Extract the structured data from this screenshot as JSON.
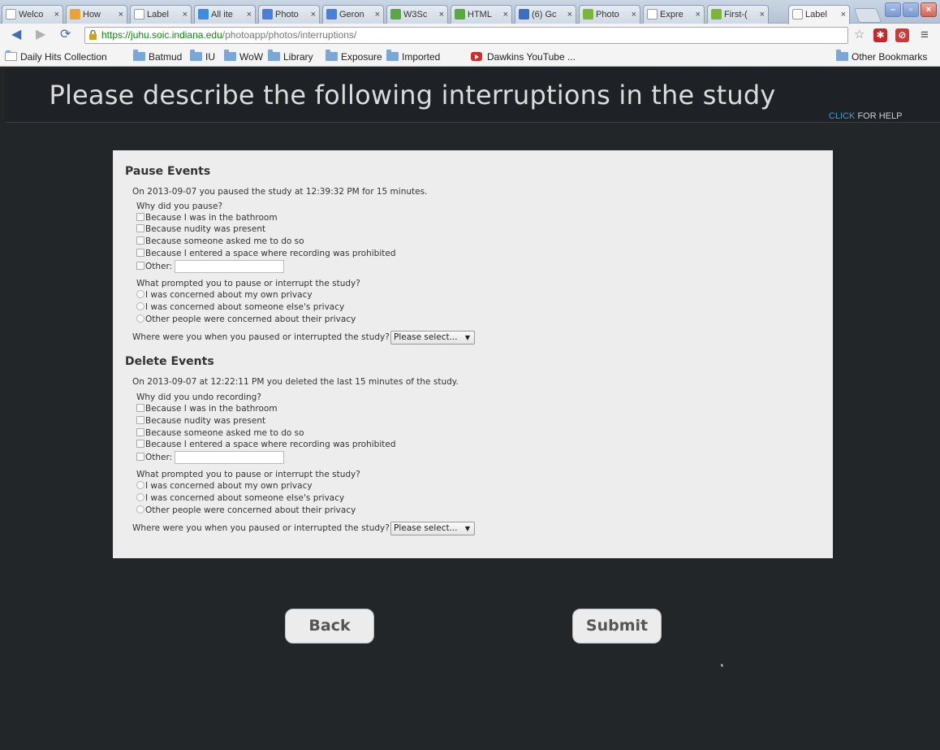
{
  "browser": {
    "tabs": [
      {
        "label": "Welco",
        "color": "#e8e8e8"
      },
      {
        "label": "How",
        "color": "#e8a33a"
      },
      {
        "label": "Label",
        "color": "#e8e8e8"
      },
      {
        "label": "All ite",
        "color": "#3c8de0"
      },
      {
        "label": "Photo",
        "color": "#4a7fd9"
      },
      {
        "label": "Geron",
        "color": "#4a7fd9"
      },
      {
        "label": "W3Sc",
        "color": "#5aa843"
      },
      {
        "label": "HTML",
        "color": "#5aa843"
      },
      {
        "label": "(6) Gc",
        "color": "#3c6fc4"
      },
      {
        "label": "Photo",
        "color": "#7db53a"
      },
      {
        "label": "Expre",
        "color": "#e8e8e8"
      },
      {
        "label": "First-(",
        "color": "#7db53a"
      },
      {
        "label": "Label",
        "color": "#e8e8e8"
      }
    ],
    "url_scheme": "https://",
    "url_host": "juhu.soic.indiana.edu",
    "url_path": "/photoapp/photos/interruptions/",
    "bookmarks": [
      "Daily Hits Collection",
      "Batmud",
      "IU",
      "WoW",
      "Library",
      "Exposure",
      "Imported",
      "Dawkins YouTube ...",
      "Other Bookmarks"
    ]
  },
  "header": {
    "title": "Please describe the following interruptions in the study",
    "help_link": "CLICK",
    "help_text": " FOR HELP"
  },
  "pause": {
    "title": "Pause Events",
    "summary": "On 2013-09-07 you paused the study at 12:39:32 PM for 15 minutes.",
    "why_label": "Why did you pause?",
    "reasons": [
      "Because I was in the bathroom",
      "Because nudity was present",
      "Because someone asked me to do so",
      "Because I entered a space where recording was prohibited"
    ],
    "other_label": "Other:",
    "other_value": "",
    "prompt_label": "What prompted you to pause or interrupt the study?",
    "prompts": [
      "I was concerned about my own privacy",
      "I was concerned about someone else's privacy",
      "Other people were concerned about their privacy"
    ],
    "where_label": "Where were you when you paused or interrupted the study?",
    "where_value": "Please select..."
  },
  "delete": {
    "title": "Delete Events",
    "summary": "On 2013-09-07 at 12:22:11 PM you deleted the last 15 minutes of the study.",
    "why_label": "Why did you undo recording?",
    "reasons": [
      "Because I was in the bathroom",
      "Because nudity was present",
      "Because someone asked me to do so",
      "Because I entered a space where recording was prohibited"
    ],
    "other_label": "Other:",
    "other_value": "",
    "prompt_label": "What prompted you to pause or interrupt the study?",
    "prompts": [
      "I was concerned about my own privacy",
      "I was concerned about someone else's privacy",
      "Other people were concerned about their privacy"
    ],
    "where_label": "Where were you when you paused or interrupted the study?",
    "where_value": "Please select..."
  },
  "actions": {
    "back_label": "Back",
    "submit_label": "Submit"
  }
}
